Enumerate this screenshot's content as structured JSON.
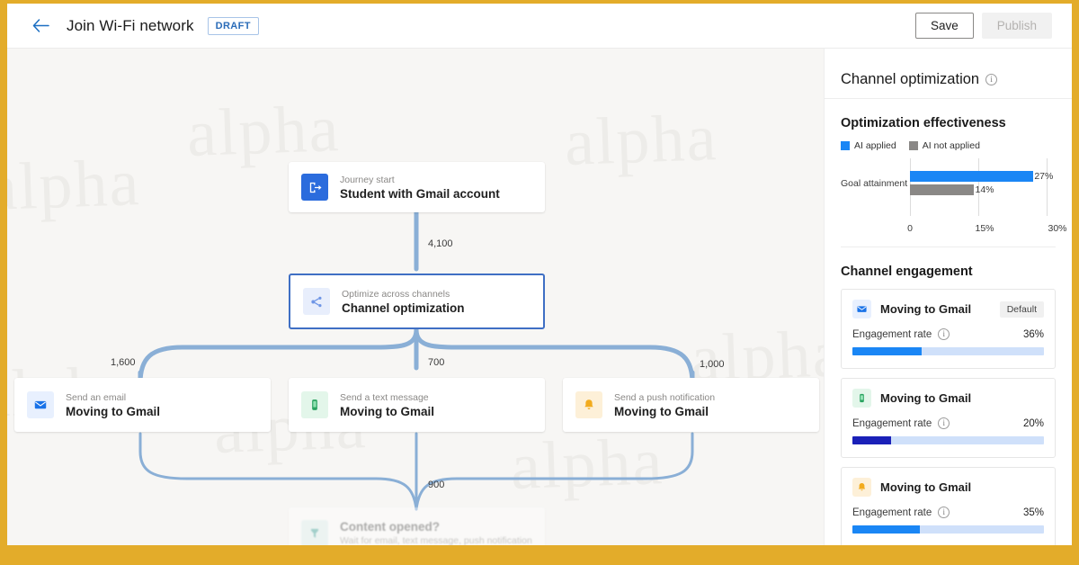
{
  "topbar": {
    "back_icon": "arrow-left-icon",
    "title": "Join Wi-Fi network",
    "status_badge": "DRAFT",
    "save_label": "Save",
    "publish_label": "Publish"
  },
  "watermark_text": "alpha",
  "colors": {
    "accent_blue": "#1a86f5",
    "node_blue": "#2b6cdd",
    "edge_blue": "#8aafd6",
    "selected_border": "#3f6fc4",
    "gray_bar": "#8a8886",
    "navy": "#1a20b8",
    "gold_frame": "#e3ac2a",
    "track_blue": "#cfe0fa"
  },
  "canvas": {
    "nodes": [
      {
        "id": "journey-start",
        "icon": "journey-start-icon",
        "subtitle": "Journey start",
        "title": "Student with Gmail account",
        "selected": false,
        "faded": false
      },
      {
        "id": "channel-optimization",
        "icon": "channel-optimization-icon",
        "subtitle": "Optimize across channels",
        "title": "Channel optimization",
        "selected": true,
        "faded": false
      },
      {
        "id": "send-email",
        "icon": "email-icon",
        "subtitle": "Send an email",
        "title": "Moving to Gmail",
        "selected": false,
        "faded": false
      },
      {
        "id": "send-text",
        "icon": "text-message-icon",
        "subtitle": "Send a text message",
        "title": "Moving to Gmail",
        "selected": false,
        "faded": false
      },
      {
        "id": "send-push",
        "icon": "push-notification-icon",
        "subtitle": "Send a push notification",
        "title": "Moving to Gmail",
        "selected": false,
        "faded": false
      },
      {
        "id": "content-opened",
        "icon": "wait-branch-icon",
        "subtitle": "Wait for email, text message, push notification",
        "title": "Content opened?",
        "selected": false,
        "faded": true
      }
    ],
    "edge_labels": {
      "start_to_optimization": "4,100",
      "to_email": "1,600",
      "to_text": "700",
      "to_push": "1,000",
      "to_content_opened": "900"
    }
  },
  "panel": {
    "title": "Channel optimization",
    "info_icon": "info-icon",
    "effectiveness": {
      "section_title": "Optimization effectiveness",
      "legend": [
        {
          "label": "AI applied",
          "color": "#1a86f5"
        },
        {
          "label": "AI not applied",
          "color": "#8a8886"
        }
      ]
    },
    "engagement": {
      "section_title": "Channel engagement",
      "rate_label": "Engagement rate",
      "rate_info_icon": "info-icon",
      "cards": [
        {
          "icon": "email-icon",
          "name": "Moving to Gmail",
          "badge": "Default",
          "rate": "36%",
          "fill_pct": 36,
          "fill_color": "#1a86f5"
        },
        {
          "icon": "text-message-icon",
          "name": "Moving to Gmail",
          "badge": "",
          "rate": "20%",
          "fill_pct": 20,
          "fill_color": "#1a20b8"
        },
        {
          "icon": "push-notification-icon",
          "name": "Moving to Gmail",
          "badge": "",
          "rate": "35%",
          "fill_pct": 35,
          "fill_color": "#1a86f5"
        }
      ]
    }
  },
  "chart_data": {
    "type": "bar",
    "orientation": "horizontal",
    "title": "Optimization effectiveness",
    "categories": [
      "Goal attainment"
    ],
    "series": [
      {
        "name": "AI applied",
        "values": [
          27
        ],
        "color": "#1a86f5",
        "labels": [
          "27%"
        ]
      },
      {
        "name": "AI not applied",
        "values": [
          14
        ],
        "color": "#8a8886",
        "labels": [
          "14%"
        ]
      }
    ],
    "xlabel": "",
    "ylabel": "",
    "xlim": [
      0,
      30
    ],
    "xticks": [
      0,
      15,
      30
    ],
    "xtick_labels": [
      "0",
      "15%",
      "30%"
    ],
    "grid": true,
    "legend_position": "top-left"
  }
}
